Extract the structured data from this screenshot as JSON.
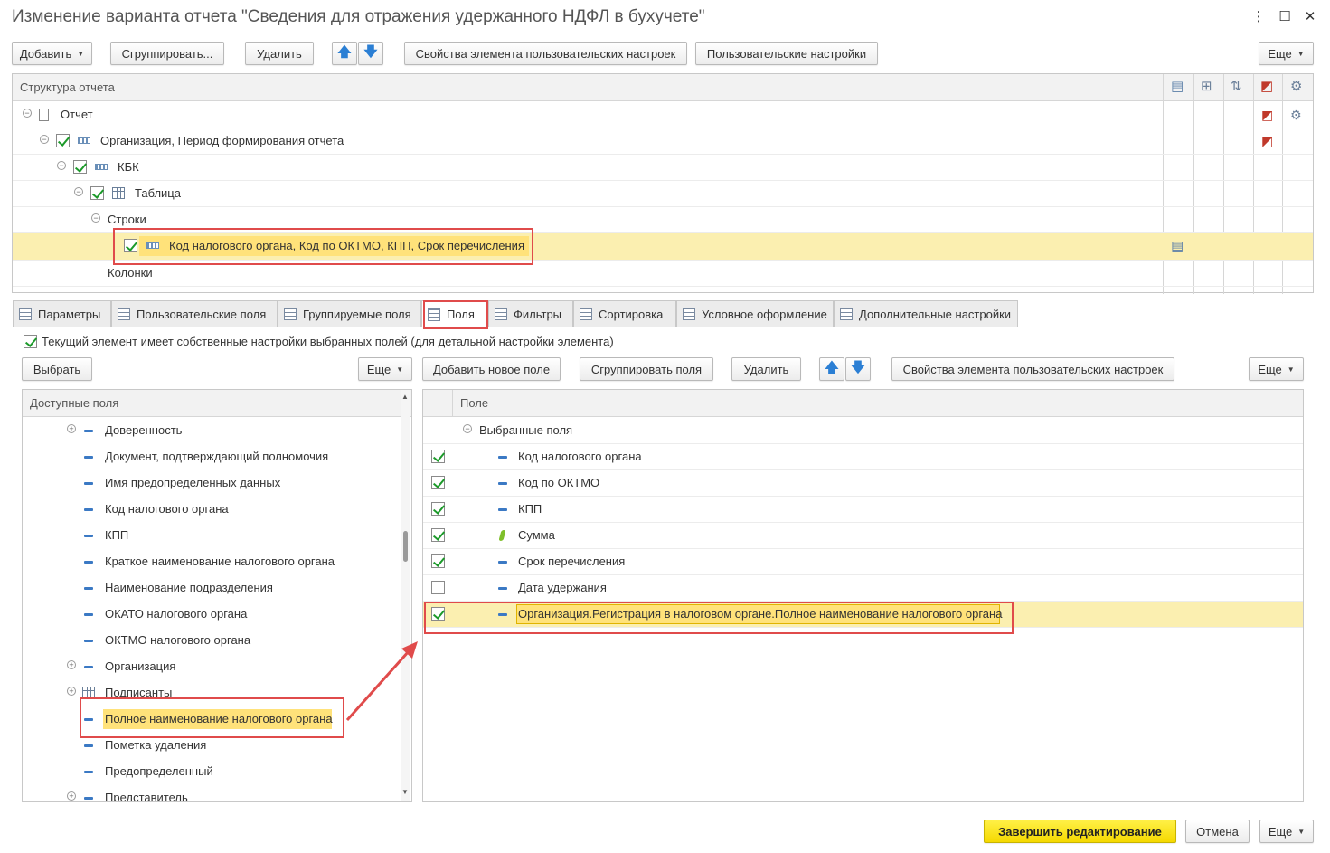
{
  "window": {
    "title": "Изменение варианта отчета \"Сведения для отражения удержанного НДФЛ в бухучете\""
  },
  "top_toolbar": {
    "add": "Добавить",
    "group": "Сгруппировать...",
    "delete": "Удалить",
    "item_props": "Свойства элемента пользовательских настроек",
    "user_settings": "Пользовательские настройки",
    "more": "Еще"
  },
  "structure": {
    "header": "Структура отчета",
    "rows": [
      {
        "label": "Отчет"
      },
      {
        "label": "Организация, Период формирования отчета"
      },
      {
        "label": "КБК"
      },
      {
        "label": "Таблица"
      },
      {
        "label": "Строки"
      },
      {
        "label": "Код налогового органа, Код по ОКТМО, КПП, Срок перечисления"
      },
      {
        "label": "Колонки"
      }
    ]
  },
  "tabs": [
    {
      "label": "Параметры"
    },
    {
      "label": "Пользовательские поля"
    },
    {
      "label": "Группируемые поля"
    },
    {
      "label": "Поля"
    },
    {
      "label": "Фильтры"
    },
    {
      "label": "Сортировка"
    },
    {
      "label": "Условное оформление"
    },
    {
      "label": "Дополнительные настройки"
    }
  ],
  "own_settings_label": "Текущий элемент имеет собственные настройки выбранных полей (для детальной настройки элемента)",
  "left": {
    "select": "Выбрать",
    "more": "Еще",
    "header": "Доступные поля",
    "items": [
      {
        "label": "Доверенность"
      },
      {
        "label": "Документ, подтверждающий полномочия"
      },
      {
        "label": "Имя предопределенных данных"
      },
      {
        "label": "Код налогового органа"
      },
      {
        "label": "КПП"
      },
      {
        "label": "Краткое наименование налогового органа"
      },
      {
        "label": "Наименование подразделения"
      },
      {
        "label": "ОКАТО налогового органа"
      },
      {
        "label": "ОКТМО налогового органа"
      },
      {
        "label": "Организация"
      },
      {
        "label": "Подписанты"
      },
      {
        "label": "Полное наименование налогового органа"
      },
      {
        "label": "Пометка удаления"
      },
      {
        "label": "Предопределенный"
      },
      {
        "label": "Представитель"
      }
    ]
  },
  "right": {
    "add_field": "Добавить новое поле",
    "group_fields": "Сгруппировать поля",
    "delete": "Удалить",
    "item_props": "Свойства элемента пользовательских настроек",
    "more": "Еще",
    "header": "Поле",
    "root": "Выбранные поля",
    "items": [
      {
        "label": "Код налогового органа",
        "checked": true
      },
      {
        "label": "Код по ОКТМО",
        "checked": true
      },
      {
        "label": "КПП",
        "checked": true
      },
      {
        "label": "Сумма",
        "checked": true
      },
      {
        "label": "Срок перечисления",
        "checked": true
      },
      {
        "label": "Дата удержания",
        "checked": false
      },
      {
        "label": "Организация.Регистрация в налоговом органе.Полное наименование налогового органа",
        "checked": true
      }
    ]
  },
  "footer": {
    "finish": "Завершить редактирование",
    "cancel": "Отмена",
    "more": "Еще"
  }
}
